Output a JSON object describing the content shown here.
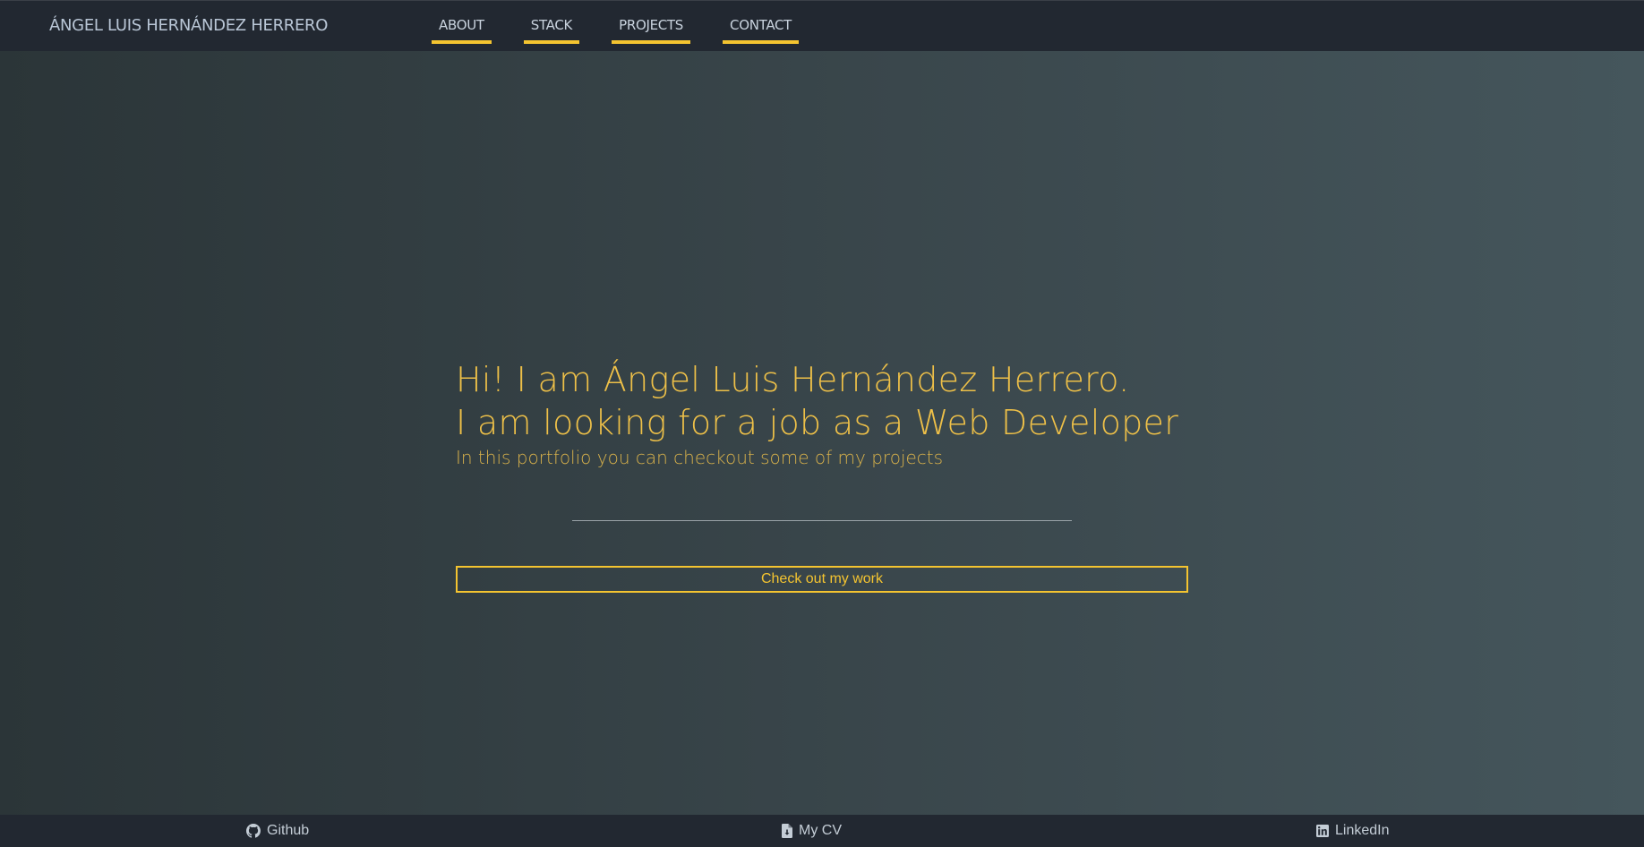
{
  "header": {
    "brand": "ÁNGEL LUIS HERNÁNDEZ HERRERO",
    "nav": [
      {
        "label": "ABOUT"
      },
      {
        "label": "STACK"
      },
      {
        "label": "PROJECTS"
      },
      {
        "label": "CONTACT"
      }
    ]
  },
  "hero": {
    "line1": "Hi! I am Ángel Luis Hernández Herrero.",
    "line2": "I am looking for a job as a Web Developer",
    "subtitle": "In this portfolio you can checkout some of my projects",
    "cta_label": "Check out my work"
  },
  "footer": {
    "links": [
      {
        "label": "Github",
        "icon": "github-icon"
      },
      {
        "label": "My CV",
        "icon": "file-download-icon"
      },
      {
        "label": "LinkedIn",
        "icon": "linkedin-icon"
      }
    ]
  },
  "colors": {
    "accent": "#f4c430",
    "nav_background": "#222831",
    "hero_text": "#eec048"
  }
}
